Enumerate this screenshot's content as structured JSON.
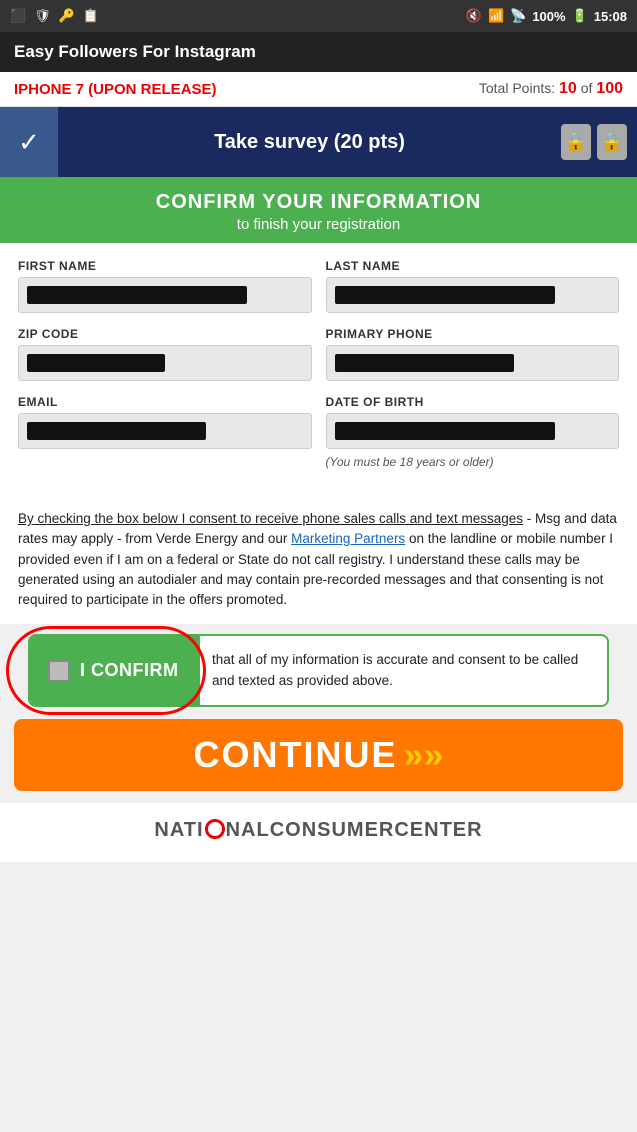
{
  "statusBar": {
    "time": "15:08",
    "battery": "100%",
    "signal": "4G",
    "wifi": "WiFi"
  },
  "appHeader": {
    "title": "Easy Followers For Instagram"
  },
  "prizeBar": {
    "prize": "IPHONE 7 (UPON RELEASE)",
    "pointsLabel": "Total Points:",
    "pointsCurrent": "10",
    "pointsOf": "of",
    "pointsTotal": "100"
  },
  "surveyBanner": {
    "text": "Take survey  (20 pts)"
  },
  "confirmHeader": {
    "title": "CONFIRM YOUR INFORMATION",
    "subtitle": "to finish your registration"
  },
  "form": {
    "firstNameLabel": "FIRST NAME",
    "lastNameLabel": "LAST NAME",
    "zipCodeLabel": "ZIP CODE",
    "primaryPhoneLabel": "PRIMARY PHONE",
    "emailLabel": "EMAIL",
    "dateOfBirthLabel": "DATE OF BIRTH",
    "dobNote": "(You must be 18 years or older)"
  },
  "consentText": {
    "linkText": "By checking the box below I consent to receive phone sales calls and text messages",
    "body": " - Msg and data rates may apply - from Verde Energy and our ",
    "marketingLink": "Marketing Partners",
    "rest": " on the landline or mobile number I provided even if I am on a federal or State do not call registry. I understand these calls may be generated using an autodialer and may contain pre-recorded messages and that consenting is not required to participate in the offers promoted."
  },
  "confirmBox": {
    "buttonLabel": "I CONFIRM",
    "description": "that all of my information is accurate and consent to be called and texted as provided above."
  },
  "continueBtn": {
    "label": "CONTINUE",
    "arrows": "»"
  },
  "footer": {
    "logo": "NATI",
    "logoMiddle": "NALCONSUMERCENTER"
  }
}
